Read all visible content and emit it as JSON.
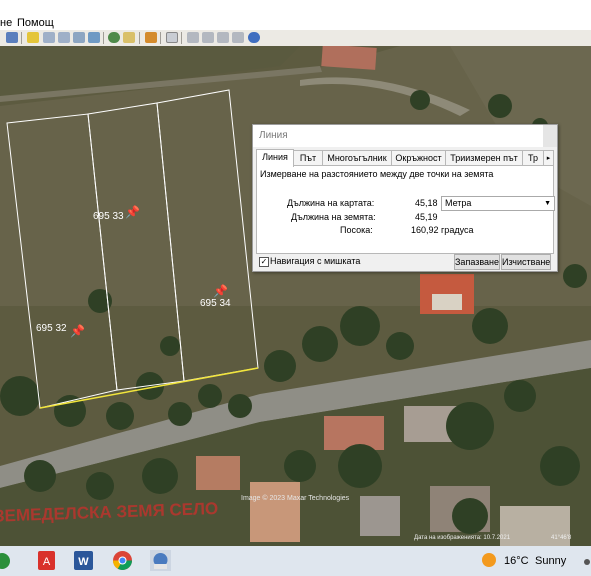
{
  "menu": {
    "item1": "не",
    "item2": "Помощ"
  },
  "map": {
    "parcels": [
      "695 33",
      "695 34",
      "695 32"
    ],
    "watermark": "ЗЕМЕДЕЛСКА ЗЕМЯ СЕЛО",
    "copyright": "Image © 2023 Maxar Technologies",
    "date_text": "Дата на изображенията: 10.7.2021",
    "coord_text": "41°46'8"
  },
  "dialog": {
    "title": "Линия",
    "tabs": [
      "Линия",
      "Път",
      "Многоъгълник",
      "Окръжност",
      "Триизмерен път",
      "Тр"
    ],
    "description": "Измерване на разстоянието между две точки на земята",
    "map_length_label": "Дължина на картата:",
    "map_length_value": "45,18",
    "unit": "Метра",
    "ground_length_label": "Дължина на земята:",
    "ground_length_value": "45,19",
    "heading_label": "Посока:",
    "heading_value": "160,92 градуса",
    "mouse_nav_label": "Навигация с мишката",
    "save_button": "Запазване",
    "clear_button": "Изчистване"
  },
  "taskbar": {
    "weather_temp": "16°C",
    "weather_text": "Sunny"
  }
}
